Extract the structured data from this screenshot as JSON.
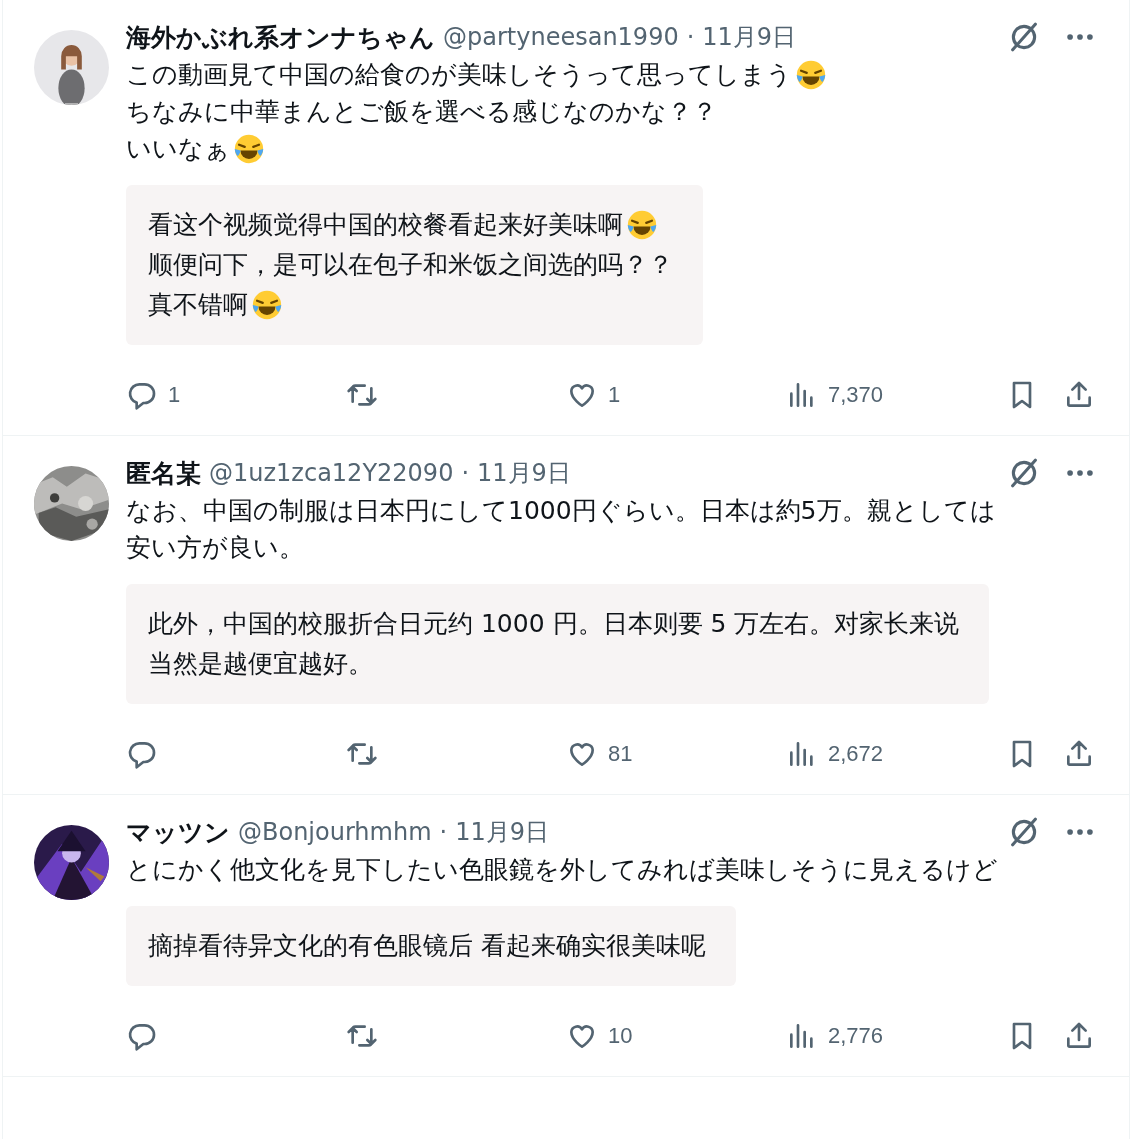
{
  "tweets": [
    {
      "name": "海外かぶれ系オンナちゃん",
      "handle": "@partyneesan1990",
      "separator": "·",
      "date": "11月9日",
      "body": [
        {
          "text": "この動画見て中国の給食のが美味しそうって思ってしまう",
          "emoji": true
        },
        {
          "text": "ちなみに中華まんとご飯を選べる感じなのかな？？",
          "emoji": false
        },
        {
          "text": "いいなぁ",
          "emoji": true
        }
      ],
      "translation": [
        {
          "text": "看这个视频觉得中国的校餐看起来好美味啊",
          "emoji": true
        },
        {
          "text": "顺便问下，是可以在包子和米饭之间选的吗？？",
          "emoji": false
        },
        {
          "text": "真不错啊",
          "emoji": true
        }
      ],
      "actions": {
        "replies": "1",
        "likes": "1",
        "views": "7,370"
      }
    },
    {
      "name": "匿名某",
      "handle": "@1uz1zca12Y22090",
      "separator": "·",
      "date": "11月9日",
      "body": [
        {
          "text": "なお、中国の制服は日本円にして1000円ぐらい。日本は約5万。親としては",
          "emoji": false
        },
        {
          "text": "安い方が良い。",
          "emoji": false
        }
      ],
      "translation": [
        {
          "text": "此外，中国的校服折合日元约 1000 円。日本则要 5 万左右。对家长来说",
          "emoji": false
        },
        {
          "text": "当然是越便宜越好。",
          "emoji": false
        }
      ],
      "actions": {
        "likes": "81",
        "views": "2,672"
      }
    },
    {
      "name": "マッツン",
      "handle": "@Bonjourhmhm",
      "separator": "·",
      "date": "11月9日",
      "body": [
        {
          "text": "とにかく他文化を見下したい色眼鏡を外してみれば美味しそうに見えるけど",
          "emoji": false
        }
      ],
      "translation": [
        {
          "text": "摘掉看待异文化的有色眼镜后 看起来确实很美味呢",
          "emoji": false
        }
      ],
      "actions": {
        "likes": "10",
        "views": "2,776"
      }
    }
  ]
}
